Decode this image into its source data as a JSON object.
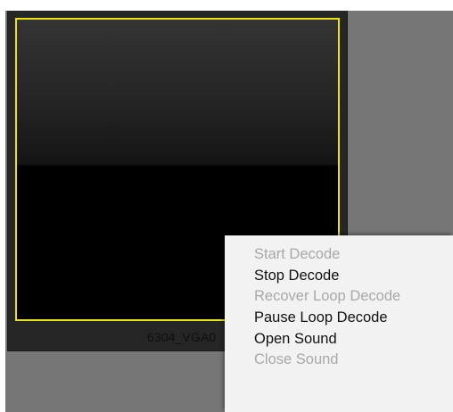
{
  "channel": {
    "label": "6304_VGA0",
    "frame_color": "#f0e012"
  },
  "context_menu": {
    "items": [
      {
        "label": "Start Decode",
        "enabled": false
      },
      {
        "label": "Stop Decode",
        "enabled": true
      },
      {
        "label": "Recover Loop Decode",
        "enabled": false
      },
      {
        "label": "Pause Loop Decode",
        "enabled": true
      },
      {
        "label": "Open Sound",
        "enabled": true
      },
      {
        "label": "Close Sound",
        "enabled": false
      }
    ]
  }
}
